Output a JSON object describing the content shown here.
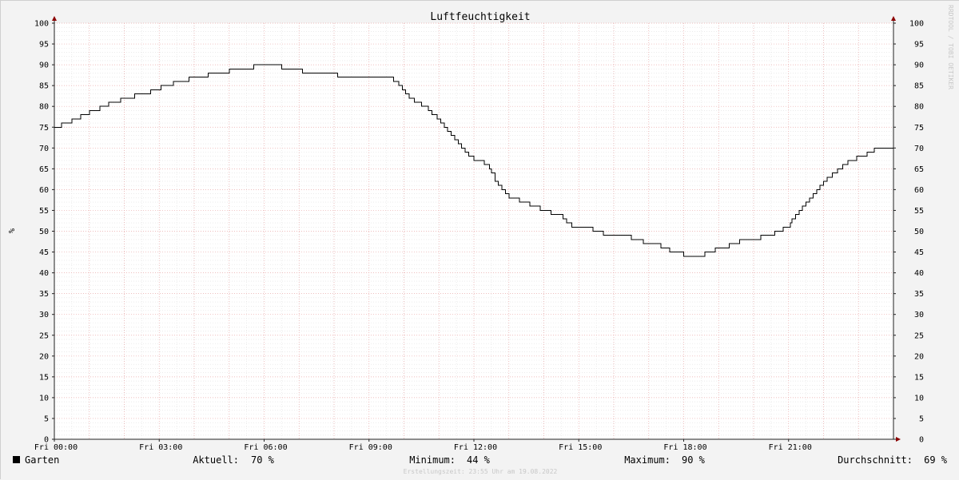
{
  "chart_data": {
    "type": "line",
    "title": "Luftfeuchtigkeit",
    "ylabel": "%",
    "watermark": "RRDTOOL / TOBI OETIKER",
    "ylim": [
      0,
      100
    ],
    "yticks": [
      0,
      5,
      10,
      15,
      20,
      25,
      30,
      35,
      40,
      45,
      50,
      55,
      60,
      65,
      70,
      75,
      80,
      85,
      90,
      95,
      100
    ],
    "xlim": [
      0,
      24
    ],
    "xticks": [
      {
        "hour": 0,
        "label": "Fri 00:00"
      },
      {
        "hour": 3,
        "label": "Fri 03:00"
      },
      {
        "hour": 6,
        "label": "Fri 06:00"
      },
      {
        "hour": 9,
        "label": "Fri 09:00"
      },
      {
        "hour": 12,
        "label": "Fri 12:00"
      },
      {
        "hour": 15,
        "label": "Fri 15:00"
      },
      {
        "hour": 18,
        "label": "Fri 18:00"
      },
      {
        "hour": 21,
        "label": "Fri 21:00"
      }
    ],
    "grid": true,
    "series": [
      {
        "name": "Garten",
        "color": "#000000",
        "step": true,
        "x": [
          0,
          0.2,
          0.5,
          0.75,
          1.0,
          1.3,
          1.55,
          1.9,
          2.3,
          2.75,
          3.05,
          3.4,
          3.85,
          4.4,
          5.0,
          5.7,
          6.5,
          7.1,
          8.1,
          8.4,
          8.9,
          9.1,
          9.7,
          9.85,
          9.95,
          10.05,
          10.15,
          10.3,
          10.5,
          10.7,
          10.8,
          10.95,
          11.05,
          11.15,
          11.25,
          11.35,
          11.45,
          11.55,
          11.65,
          11.75,
          11.85,
          12.0,
          12.3,
          12.45,
          12.5,
          12.6,
          12.7,
          12.8,
          12.9,
          13.0,
          13.3,
          13.6,
          13.9,
          14.2,
          14.55,
          14.65,
          14.8,
          15.4,
          15.7,
          16.5,
          16.85,
          17.35,
          17.6,
          18.0,
          18.6,
          18.9,
          19.3,
          19.6,
          20.2,
          20.6,
          20.85,
          21.05,
          21.1,
          21.2,
          21.3,
          21.4,
          21.5,
          21.6,
          21.7,
          21.8,
          21.9,
          22.0,
          22.1,
          22.25,
          22.4,
          22.55,
          22.7,
          22.95,
          23.25,
          23.45,
          23.75,
          24.0
        ],
        "y": [
          75,
          76,
          77,
          78,
          79,
          80,
          81,
          82,
          83,
          84,
          85,
          86,
          87,
          88,
          89,
          90,
          89,
          88,
          87,
          87,
          87,
          87,
          86,
          85,
          84,
          83,
          82,
          81,
          80,
          79,
          78,
          77,
          76,
          75,
          74,
          73,
          72,
          71,
          70,
          69,
          68,
          67,
          66,
          65,
          64,
          62,
          61,
          60,
          59,
          58,
          57,
          56,
          55,
          54,
          53,
          52,
          51,
          50,
          49,
          48,
          47,
          46,
          45,
          44,
          45,
          46,
          47,
          48,
          49,
          50,
          51,
          52,
          53,
          54,
          55,
          56,
          57,
          58,
          59,
          60,
          61,
          62,
          63,
          64,
          65,
          66,
          67,
          68,
          69,
          70,
          70,
          70
        ]
      }
    ]
  },
  "legend": {
    "series_name": "Garten",
    "swatch_color": "#000000",
    "current_label": "Aktuell:",
    "current_value": "70 %",
    "min_label": "Minimum:",
    "min_value": "44 %",
    "max_label": "Maximum:",
    "max_value": "90 %",
    "avg_label": "Durchschnitt:",
    "avg_value": "69 %"
  },
  "footer": {
    "created": "Erstellungszeit: 23:55 Uhr am 19.08.2022"
  }
}
